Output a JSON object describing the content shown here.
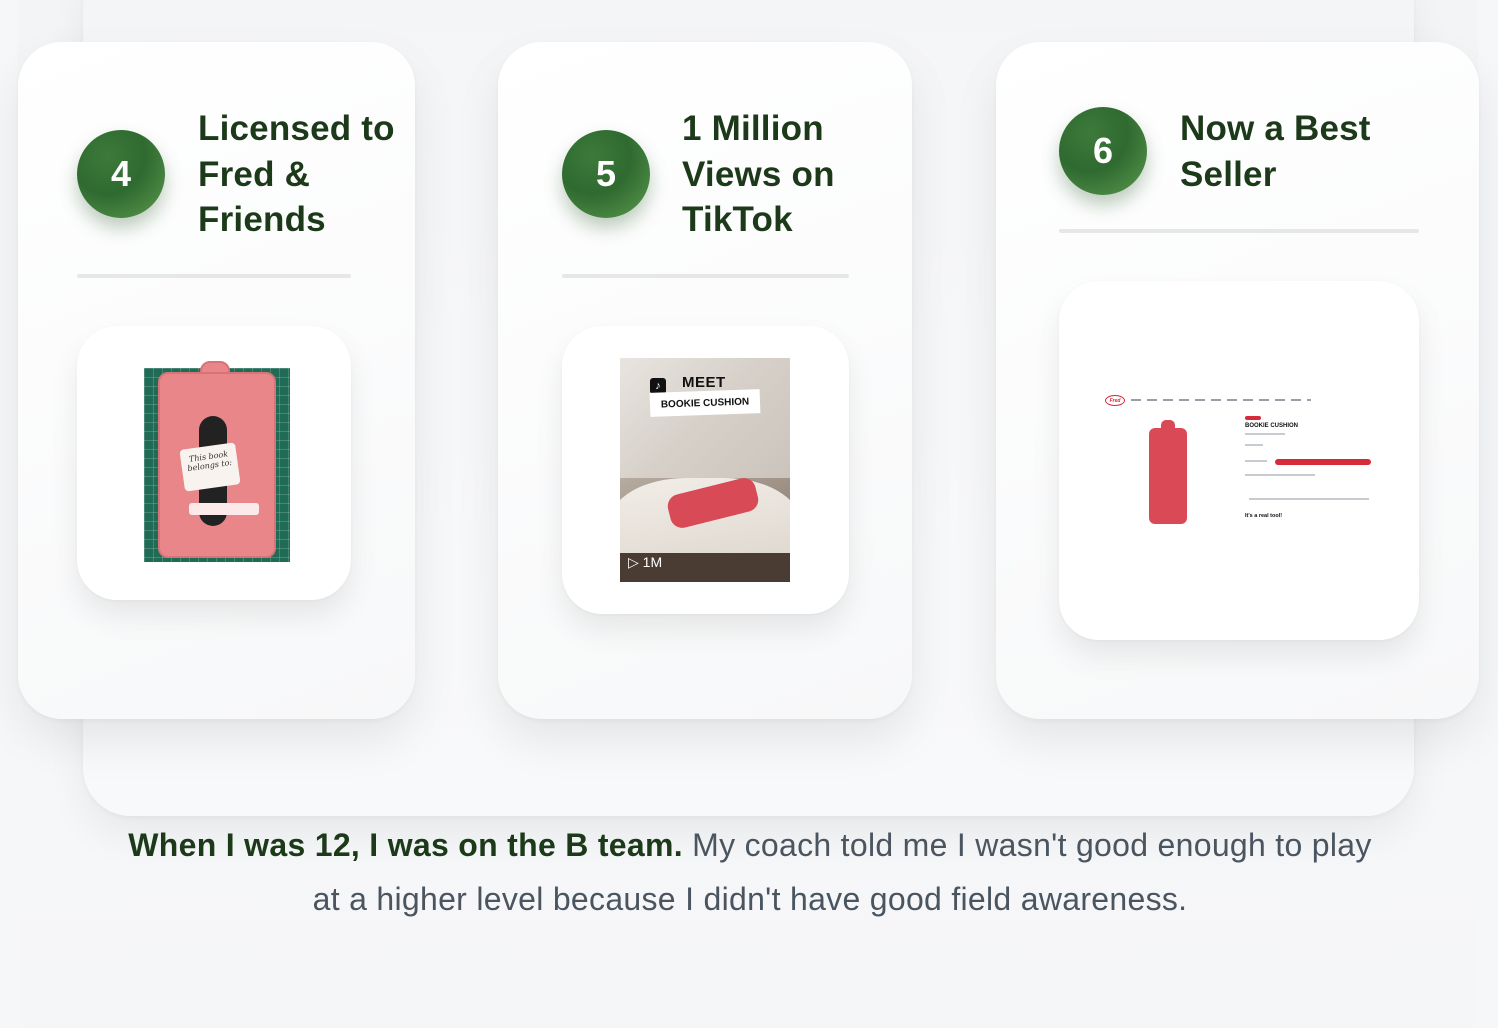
{
  "steps": [
    {
      "number": "4",
      "title": "Licensed to Fred & Friends",
      "image": "bookie-cushion-prototype-photo"
    },
    {
      "number": "5",
      "title": "1 Million Views on TikTok",
      "image": "tiktok-video-thumbnail",
      "tiktok": {
        "meet": "MEET",
        "banner": "BOOKIE CUSHION",
        "views": "1M"
      }
    },
    {
      "number": "6",
      "title": "Now a Best Seller",
      "image": "fred-product-page-screenshot",
      "webpage": {
        "logo": "Fred",
        "product_title": "BOOKIE CUSHION",
        "footer": "It's a real tool!"
      }
    }
  ],
  "prototype": {
    "book_text": "This book belongs to:"
  },
  "caption": {
    "bold": "When I was 12, I was on the B team.",
    "rest": " My coach told me I wasn't good enough to play at a higher level because I didn't have good field awareness."
  },
  "colors": {
    "accent_green": "#2f6a30",
    "title_green": "#1c3a1a",
    "body_gray": "#4a5560"
  }
}
